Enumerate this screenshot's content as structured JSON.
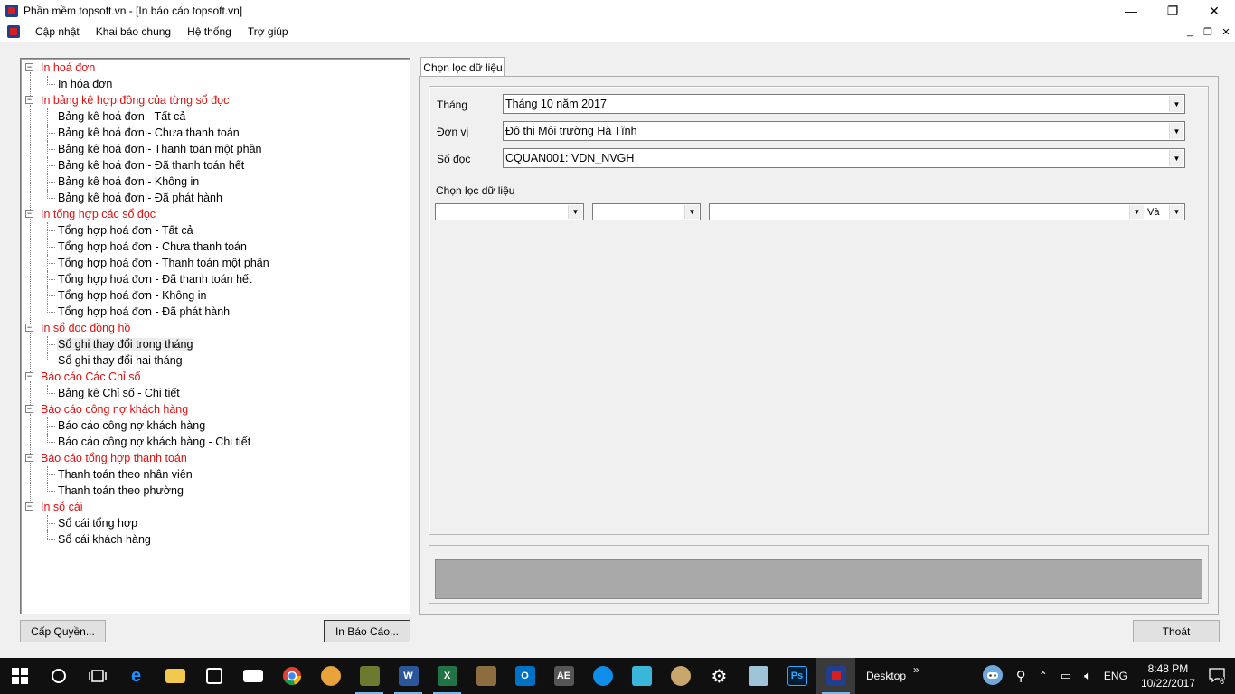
{
  "window": {
    "title": "Phần mềm topsoft.vn - [In báo cáo topsoft.vn]",
    "minimize": "—",
    "restore": "❐",
    "close": "✕"
  },
  "menu": {
    "items": [
      "Cập nhật",
      "Khai báo chung",
      "Hệ thống",
      "Trợ giúp"
    ],
    "mdi_minimize": "_",
    "mdi_restore": "❐",
    "mdi_close": "✕"
  },
  "tree": {
    "groups": [
      {
        "label": "In hoá đơn",
        "children": [
          "In hóa đơn"
        ]
      },
      {
        "label": "In bảng kê hợp đồng của từng sổ đọc",
        "children": [
          "Bảng kê hoá đơn - Tất cả",
          "Bảng kê hoá đơn - Chưa thanh toán",
          "Bảng kê hoá đơn - Thanh toán một phần",
          "Bảng kê hoá đơn - Đã thanh toán hết",
          "Bảng kê hoá đơn - Không in",
          "Bảng kê hoá đơn - Đã phát hành"
        ]
      },
      {
        "label": "In tổng hợp các sổ đọc",
        "children": [
          "Tổng hợp hoá đơn - Tất cả",
          "Tổng hợp hoá đơn - Chưa thanh toán",
          "Tổng hợp hoá đơn - Thanh toán một phần",
          "Tổng hợp hoá đơn - Đã thanh toán hết",
          "Tổng hợp hoá đơn - Không in",
          "Tổng hợp hoá đơn - Đã phát hành"
        ]
      },
      {
        "label": "In sổ đọc đồng hồ",
        "children": [
          "Sổ ghi thay đổi trong tháng",
          "Sổ ghi thay đổi hai tháng"
        ]
      },
      {
        "label": "Báo cáo Các Chỉ số",
        "children": [
          "Bảng kê Chỉ số - Chi tiết"
        ]
      },
      {
        "label": "Báo cáo công nợ khách hàng",
        "children": [
          "Báo cáo công nợ khách hàng",
          "Báo cáo công nợ khách hàng - Chi tiết"
        ]
      },
      {
        "label": "Báo cáo tổng hợp thanh toán",
        "children": [
          "Thanh toán theo nhân viên",
          "Thanh toán theo phường"
        ]
      },
      {
        "label": "In sổ cái",
        "children": [
          "Sổ cái tổng hợp",
          "Sổ cái khách hàng"
        ]
      }
    ],
    "expander_symbol": "−"
  },
  "tab": {
    "label": "Chọn lọc dữ liệu"
  },
  "form": {
    "thang_label": "Tháng",
    "thang_value": "Tháng 10 năm 2017",
    "donvi_label": "Đơn vị",
    "donvi_value": "Đô thị Môi trường Hà Tĩnh",
    "sodoc_label": "Số đọc",
    "sodoc_value": "CQUAN001: VDN_NVGH",
    "filter_label": "Chọn lọc dữ liệu",
    "filter_field_value": "",
    "filter_op_value": "",
    "filter_value": "",
    "filter_logic_value": "Và",
    "arrow": "▼"
  },
  "buttons": {
    "cap_quyen": "Cấp Quyền...",
    "in_bao_cao": "In Báo Cáo...",
    "thoat": "Thoát"
  },
  "taskbar": {
    "desktop_label": "Desktop",
    "chevrons": "»",
    "lang": "ENG",
    "time": "8:48 PM",
    "date": "10/22/2017",
    "notif_count": "6",
    "word_label": "W",
    "excel_label": "X",
    "outlook_label": "O",
    "ae_label": "AE",
    "ps_label": "Ps"
  },
  "colors": {
    "tree_parent": "#e01010",
    "taskbar_bg": "#101010",
    "status_bar": "#a9a9a9"
  }
}
